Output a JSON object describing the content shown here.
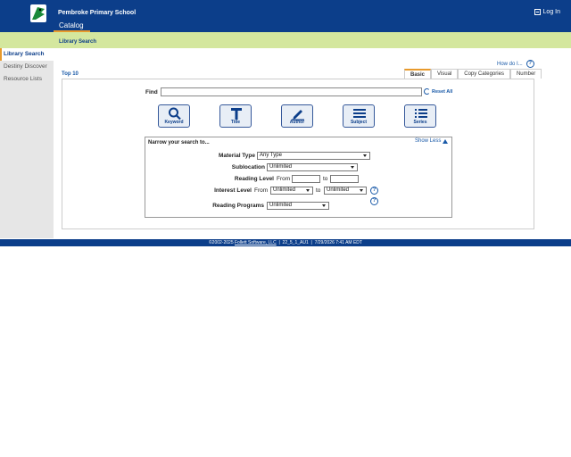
{
  "header": {
    "school_name": "Pembroke Primary School",
    "active_tab": "Catalog",
    "login_label": "Log In"
  },
  "subbar": {
    "title": "Library Search"
  },
  "sidebar": {
    "items": [
      {
        "label": "Library Search",
        "active": true
      },
      {
        "label": "Destiny Discover",
        "active": false
      },
      {
        "label": "Resource Lists",
        "active": false
      }
    ]
  },
  "help": {
    "how_do_i": "How do I...",
    "q": "?"
  },
  "top10": "Top 10",
  "tabs": [
    "Basic",
    "Visual",
    "Copy Categories",
    "Number"
  ],
  "find": {
    "label": "Find",
    "value": "",
    "reset": "Reset All"
  },
  "search_buttons": [
    "Keyword",
    "Title",
    "Author",
    "Subject",
    "Series"
  ],
  "narrow": {
    "title": "Narrow your search to...",
    "show_less": "Show Less",
    "material_type": {
      "label": "Material Type",
      "value": "Any Type"
    },
    "sublocation": {
      "label": "Sublocation",
      "value": "Unlimited"
    },
    "reading_level": {
      "label": "Reading Level",
      "from": "From",
      "to": "to"
    },
    "interest_level": {
      "label": "Interest Level",
      "from": "From",
      "to": "to",
      "from_value": "Unlimited",
      "to_value": "Unlimited"
    },
    "reading_programs": {
      "label": "Reading Programs",
      "value": "Unlimited"
    }
  },
  "footer": {
    "copyright": "©2002-2025",
    "company": "Follett Software, LLC",
    "version": "22_5_1_AU1",
    "datetime": "7/29/2026 7:41 AM EDT"
  },
  "colors": {
    "header": "#0c3e8a",
    "subbar": "#d4e79e",
    "accent": "#e89a2c"
  }
}
